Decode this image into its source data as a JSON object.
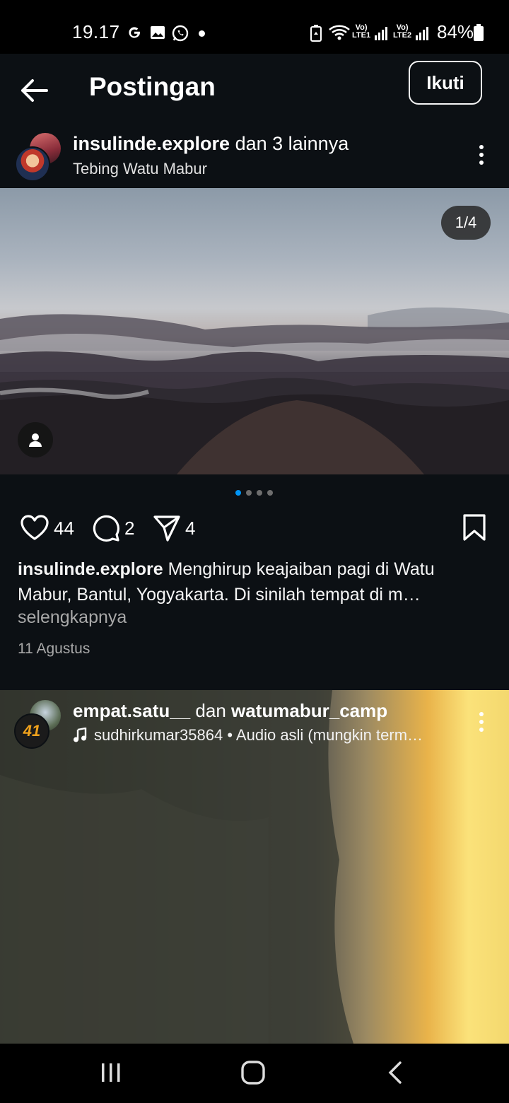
{
  "status_bar": {
    "time": "19.17",
    "network1": "Vo) LTE1",
    "network2": "Vo) LTE2",
    "battery": "84%",
    "icons": [
      "google-icon",
      "gallery-icon",
      "whatsapp-icon",
      "dot-icon",
      "battery-saver-icon",
      "wifi-icon",
      "signal-icon",
      "signal-icon",
      "battery-icon"
    ]
  },
  "header": {
    "title": "Postingan",
    "follow_label": "Ikuti"
  },
  "post1": {
    "username": "insulinde.explore",
    "coauthors": "dan 3 lainnya",
    "location": "Tebing Watu Mabur",
    "image_counter": "1/4",
    "carousel_active_index": 0,
    "carousel_total": 4,
    "likes": "44",
    "comments": "2",
    "shares": "4",
    "caption_user": "insulinde.explore",
    "caption_text": "Menghirup keajaiban pagi di Watu Mabur, Bantul, Yogyakarta. Di sinilah tempat di m…",
    "more_label": "selengkapnya",
    "date": "11 Agustus"
  },
  "post2": {
    "username": "empat.satu__",
    "conjunction": "dan",
    "coauthor": "watumabur_camp",
    "avatar_text": "41",
    "audio": "sudhirkumar35864 • Audio asli (mungkin term…"
  },
  "colors": {
    "background": "#0c1014",
    "accent_dot": "#0095f6",
    "muted_text": "#a8a8a8"
  }
}
